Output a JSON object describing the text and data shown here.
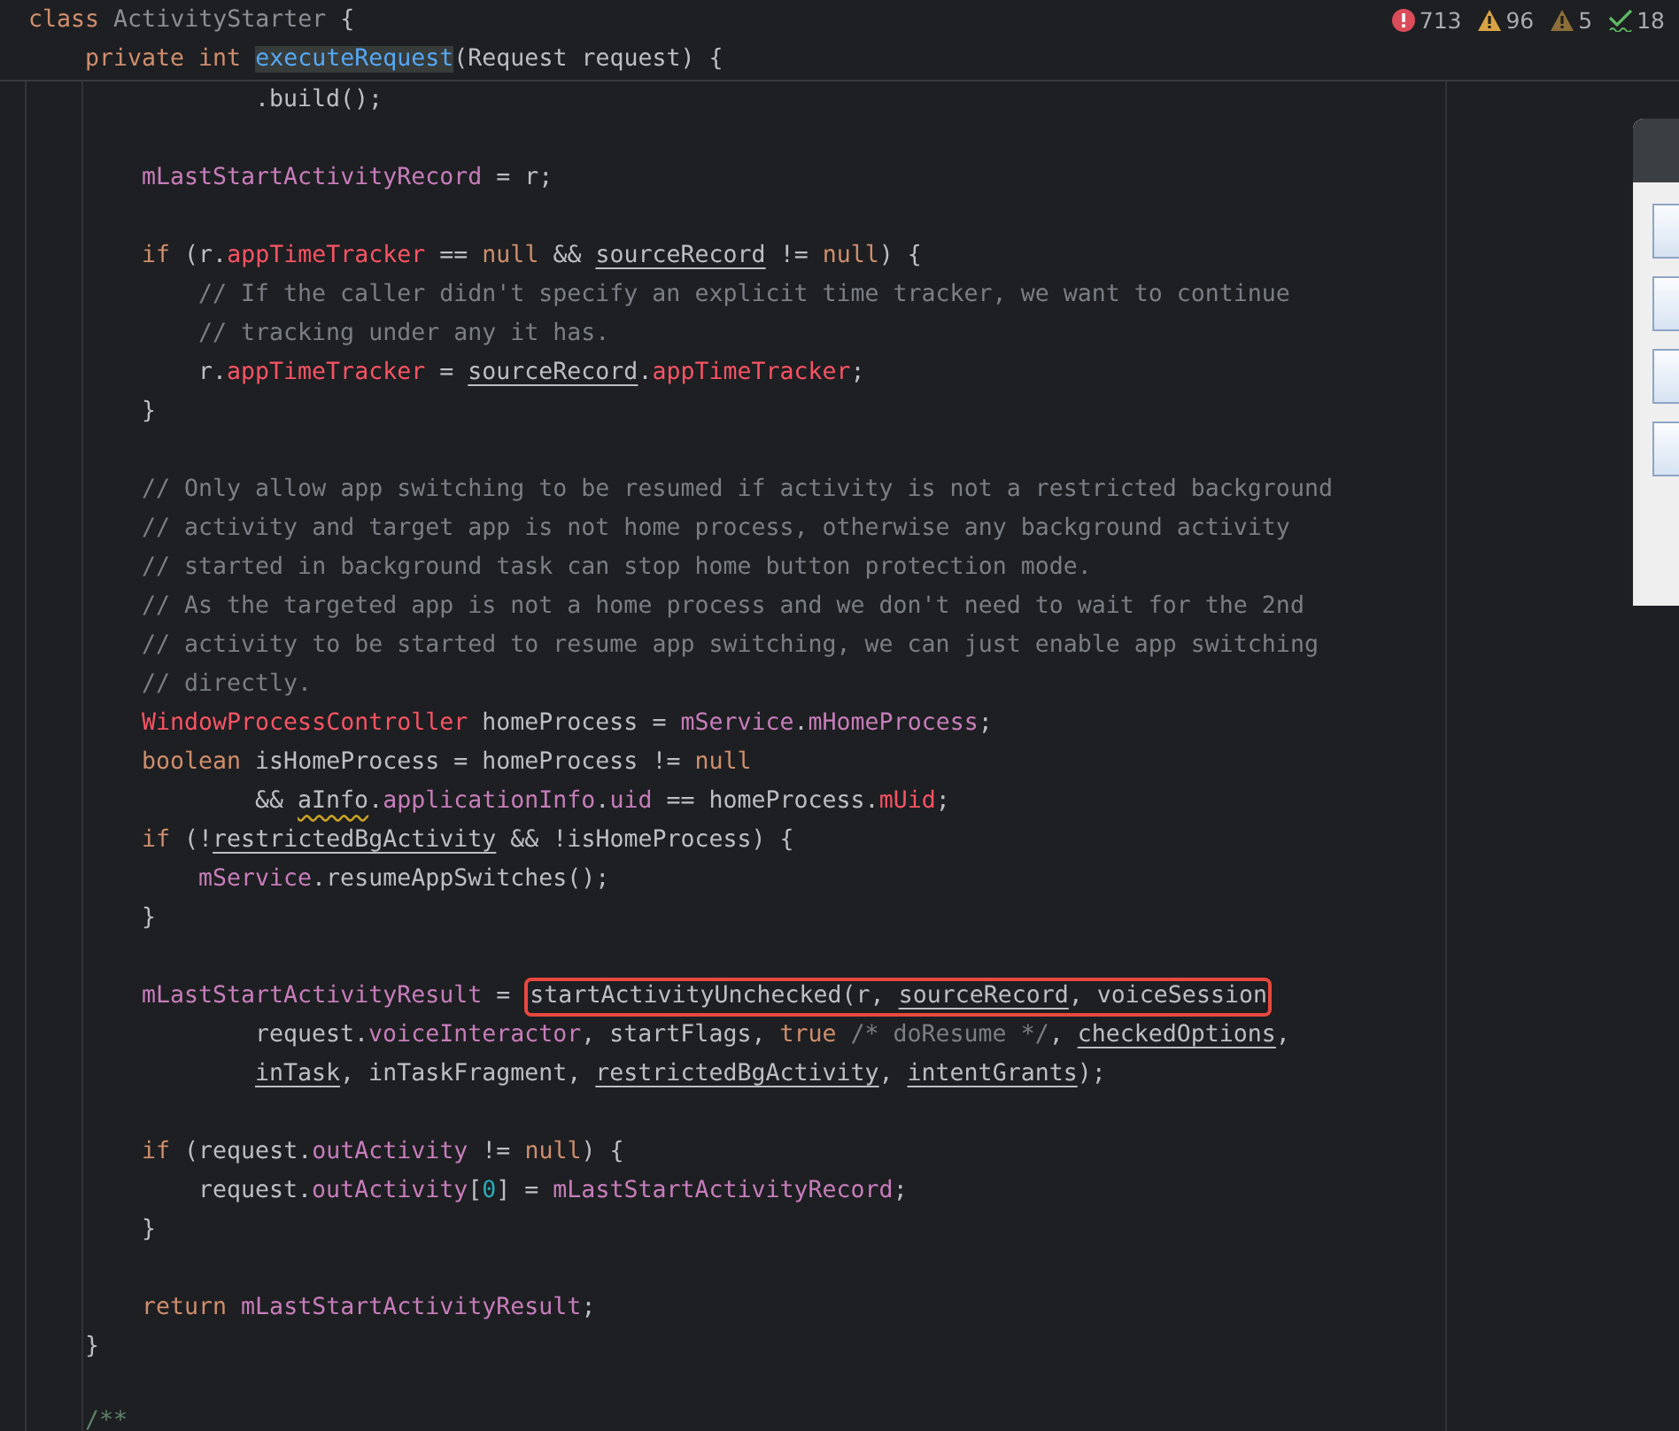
{
  "sticky_header": [
    {
      "tokens": [
        {
          "text": "class ",
          "kind": "keyword"
        },
        {
          "text": "ActivityStarter ",
          "kind": "muted"
        },
        {
          "text": "{",
          "kind": "plain"
        }
      ]
    },
    {
      "tokens": [
        {
          "text": "    private int ",
          "kind": "keyword"
        },
        {
          "text": "executeRequest",
          "kind": "method",
          "selected": true
        },
        {
          "text": "(Request request) {",
          "kind": "plain"
        }
      ]
    }
  ],
  "inspections": [
    {
      "kind": "error",
      "text": "713"
    },
    {
      "kind": "warning",
      "text": "96"
    },
    {
      "kind": "weak",
      "text": "5"
    },
    {
      "kind": "typo",
      "text": "18"
    }
  ],
  "code_lines": [
    {
      "tokens": [
        {
          "text": "                .build();",
          "kind": "plain"
        }
      ]
    },
    {
      "kind": "blank"
    },
    {
      "tokens": [
        {
          "text": "        mLastStartActivityRecord",
          "kind": "field"
        },
        {
          "text": " = r;",
          "kind": "plain"
        }
      ]
    },
    {
      "kind": "blank"
    },
    {
      "tokens": [
        {
          "text": "        if ",
          "kind": "keyword"
        },
        {
          "text": "(r.",
          "kind": "plain"
        },
        {
          "text": "appTimeTracker",
          "kind": "error"
        },
        {
          "text": " == ",
          "kind": "plain"
        },
        {
          "text": "null ",
          "kind": "keyword"
        },
        {
          "text": "&& ",
          "kind": "plain"
        },
        {
          "text": "sourceRecord",
          "kind": "plain",
          "underline": true
        },
        {
          "text": " != ",
          "kind": "plain"
        },
        {
          "text": "null",
          "kind": "keyword"
        },
        {
          "text": ") {",
          "kind": "plain"
        }
      ]
    },
    {
      "tokens": [
        {
          "text": "            // If the caller didn't specify an explicit time tracker, we want to continue",
          "kind": "comment"
        }
      ]
    },
    {
      "tokens": [
        {
          "text": "            // tracking under any it has.",
          "kind": "comment"
        }
      ]
    },
    {
      "tokens": [
        {
          "text": "            r.",
          "kind": "plain"
        },
        {
          "text": "appTimeTracker",
          "kind": "error"
        },
        {
          "text": " = ",
          "kind": "plain"
        },
        {
          "text": "sourceRecord",
          "kind": "plain",
          "underline": true
        },
        {
          "text": ".",
          "kind": "plain"
        },
        {
          "text": "appTimeTracker",
          "kind": "error"
        },
        {
          "text": ";",
          "kind": "plain"
        }
      ]
    },
    {
      "tokens": [
        {
          "text": "        }",
          "kind": "plain"
        }
      ]
    },
    {
      "kind": "blank"
    },
    {
      "tokens": [
        {
          "text": "        // Only allow app switching to be resumed if activity is not a restricted background",
          "kind": "comment"
        }
      ]
    },
    {
      "tokens": [
        {
          "text": "        // activity and target app is not home process, otherwise any background activity",
          "kind": "comment"
        }
      ]
    },
    {
      "tokens": [
        {
          "text": "        // started in background task can stop home button protection mode.",
          "kind": "comment"
        }
      ]
    },
    {
      "tokens": [
        {
          "text": "        // As the targeted app is not a home process and we don't need to wait for the 2nd",
          "kind": "comment"
        }
      ]
    },
    {
      "tokens": [
        {
          "text": "        // activity to be started to resume app switching, we can just enable app switching",
          "kind": "comment"
        }
      ]
    },
    {
      "tokens": [
        {
          "text": "        // directly.",
          "kind": "comment"
        }
      ]
    },
    {
      "tokens": [
        {
          "text": "        WindowProcessController",
          "kind": "error"
        },
        {
          "text": " homeProcess = ",
          "kind": "plain"
        },
        {
          "text": "mService",
          "kind": "field"
        },
        {
          "text": ".",
          "kind": "plain"
        },
        {
          "text": "mHomeProcess",
          "kind": "field"
        },
        {
          "text": ";",
          "kind": "plain"
        }
      ]
    },
    {
      "tokens": [
        {
          "text": "        boolean ",
          "kind": "keyword"
        },
        {
          "text": "isHomeProcess = homeProcess != ",
          "kind": "plain"
        },
        {
          "text": "null",
          "kind": "keyword"
        }
      ]
    },
    {
      "tokens": [
        {
          "text": "                && ",
          "kind": "plain"
        },
        {
          "text": "aInfo",
          "kind": "plain",
          "squiggle": true
        },
        {
          "text": ".",
          "kind": "plain"
        },
        {
          "text": "applicationInfo",
          "kind": "field"
        },
        {
          "text": ".",
          "kind": "plain"
        },
        {
          "text": "uid",
          "kind": "field"
        },
        {
          "text": " == homeProcess.",
          "kind": "plain"
        },
        {
          "text": "mUid",
          "kind": "error"
        },
        {
          "text": ";",
          "kind": "plain"
        }
      ]
    },
    {
      "tokens": [
        {
          "text": "        if ",
          "kind": "keyword"
        },
        {
          "text": "(!",
          "kind": "plain"
        },
        {
          "text": "restrictedBgActivity",
          "kind": "plain",
          "underline": true
        },
        {
          "text": " && !isHomeProcess) {",
          "kind": "plain"
        }
      ]
    },
    {
      "tokens": [
        {
          "text": "            mService",
          "kind": "field"
        },
        {
          "text": ".resumeAppSwitches();",
          "kind": "plain"
        }
      ]
    },
    {
      "tokens": [
        {
          "text": "        }",
          "kind": "plain"
        }
      ]
    },
    {
      "kind": "blank"
    },
    {
      "tokens": [
        {
          "text": "        mLastStartActivityResult",
          "kind": "field"
        },
        {
          "text": " = ",
          "kind": "plain"
        },
        {
          "kind": "annotation-box",
          "tokens": [
            {
              "text": "startActivityUnchecked(r, ",
              "kind": "plain"
            },
            {
              "text": "sourceRecord",
              "kind": "plain",
              "underline": true
            },
            {
              "text": ", voiceSession",
              "kind": "plain"
            }
          ]
        }
      ]
    },
    {
      "tokens": [
        {
          "text": "                request.",
          "kind": "plain"
        },
        {
          "text": "voiceInteractor",
          "kind": "field"
        },
        {
          "text": ", startFlags, ",
          "kind": "plain"
        },
        {
          "text": "true ",
          "kind": "keyword"
        },
        {
          "text": "/* doResume */",
          "kind": "comment"
        },
        {
          "text": ", ",
          "kind": "plain"
        },
        {
          "text": "checkedOptions",
          "kind": "plain",
          "underline": true
        },
        {
          "text": ",",
          "kind": "plain"
        }
      ]
    },
    {
      "tokens": [
        {
          "text": "                inTask",
          "kind": "plain",
          "underline": true
        },
        {
          "text": ", inTaskFragment, ",
          "kind": "plain"
        },
        {
          "text": "restrictedBgActivity",
          "kind": "plain",
          "underline": true
        },
        {
          "text": ", ",
          "kind": "plain"
        },
        {
          "text": "intentGrants",
          "kind": "plain",
          "underline": true
        },
        {
          "text": ");",
          "kind": "plain"
        }
      ]
    },
    {
      "kind": "blank"
    },
    {
      "tokens": [
        {
          "text": "        if ",
          "kind": "keyword"
        },
        {
          "text": "(request.",
          "kind": "plain"
        },
        {
          "text": "outActivity",
          "kind": "field"
        },
        {
          "text": " != ",
          "kind": "plain"
        },
        {
          "text": "null",
          "kind": "keyword"
        },
        {
          "text": ") {",
          "kind": "plain"
        }
      ]
    },
    {
      "tokens": [
        {
          "text": "            request.",
          "kind": "plain"
        },
        {
          "text": "outActivity",
          "kind": "field"
        },
        {
          "text": "[",
          "kind": "plain"
        },
        {
          "text": "0",
          "kind": "number"
        },
        {
          "text": "] = ",
          "kind": "plain"
        },
        {
          "text": "mLastStartActivityRecord",
          "kind": "field"
        },
        {
          "text": ";",
          "kind": "plain"
        }
      ]
    },
    {
      "tokens": [
        {
          "text": "        }",
          "kind": "plain"
        }
      ]
    },
    {
      "kind": "blank"
    },
    {
      "tokens": [
        {
          "text": "        return ",
          "kind": "keyword"
        },
        {
          "text": "mLastStartActivityResult",
          "kind": "field"
        },
        {
          "text": ";",
          "kind": "plain"
        }
      ]
    },
    {
      "tokens": [
        {
          "text": "    }",
          "kind": "plain"
        }
      ]
    },
    {
      "kind": "blank"
    },
    {
      "kind": "last",
      "tokens": [
        {
          "text": "    /**",
          "kind": "doc"
        }
      ]
    }
  ]
}
